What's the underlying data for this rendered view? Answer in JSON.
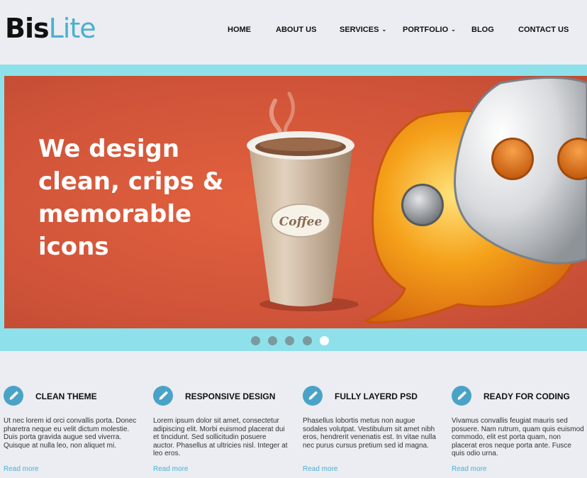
{
  "brand": {
    "part1": "Bis",
    "part2": "Lite"
  },
  "nav": [
    {
      "label": "HOME",
      "caret": ""
    },
    {
      "label": "ABOUT US",
      "caret": ""
    },
    {
      "label": "SERVICES",
      "caret": "⌄"
    },
    {
      "label": "PORTFOLIO",
      "caret": "⌄"
    },
    {
      "label": "BLOG",
      "caret": ""
    },
    {
      "label": "CONTACT US",
      "caret": ""
    }
  ],
  "hero": {
    "lines": [
      "We design",
      "clean, crips &",
      "memorable",
      "icons"
    ],
    "cup_label": "Coffee",
    "active_slide": 5,
    "slide_count": 5
  },
  "features": [
    {
      "title": "CLEAN THEME",
      "text": "Ut nec lorem id orci convallis porta. Donec pharetra neque eu velit dictum molestie. Duis porta gravida augue sed viverra. Quisque at nulla leo, non aliquet mi.",
      "link": "Read more",
      "icon": "pencil-icon"
    },
    {
      "title": "RESPONSIVE DESIGN",
      "text": "Lorem ipsum dolor sit amet, consectetur adipiscing elit. Morbi euismod placerat dui et tincidunt. Sed sollicitudin posuere auctor. Phasellus at ultricies nisl. Integer at leo eros.",
      "link": "Read more",
      "icon": "pencil-icon"
    },
    {
      "title": "FULLY LAYERD PSD",
      "text": "Phasellus lobortis metus non augue sodales volutpat. Vestibulum sit amet nibh eros, hendrerit venenatis est. In vitae nulla nec purus cursus pretium sed id magna.",
      "link": "Read more",
      "icon": "pencil-icon"
    },
    {
      "title": "READY FOR CODING",
      "text": "Vivamus convallis feugiat mauris sed posuere. Nam rutrum, quam quis euismod commodo, elit est porta quam, non placerat eros neque porta ante. Fusce quis odio urna.",
      "link": "Read more",
      "icon": "pencil-icon"
    }
  ],
  "colors": {
    "accent": "#4ab0d0",
    "slider_band": "#8ee1ea",
    "slide_bg": "#d2553a",
    "icon_bg": "#4aa3c6"
  }
}
